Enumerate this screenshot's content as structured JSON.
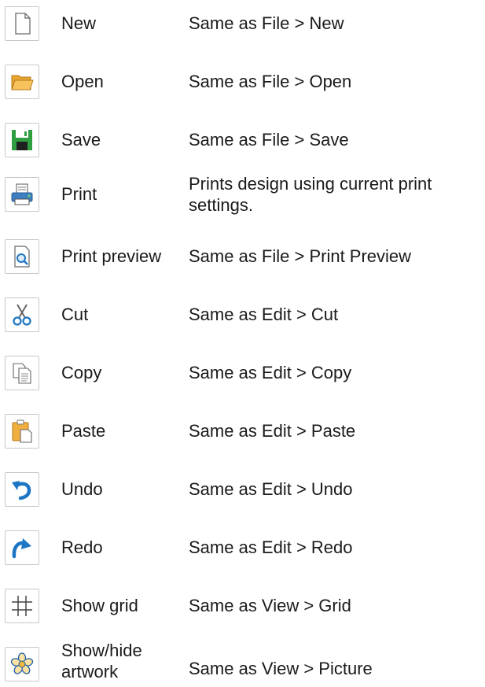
{
  "rows": [
    {
      "icon": "new-document-icon",
      "name": "New",
      "desc": "Same as File > New"
    },
    {
      "icon": "open-folder-icon",
      "name": "Open",
      "desc": "Same as File > Open"
    },
    {
      "icon": "save-floppy-icon",
      "name": "Save",
      "desc": "Same as File > Save"
    },
    {
      "icon": "printer-icon",
      "name": "Print",
      "desc_line1": "Prints design using current print",
      "desc_line2": "settings."
    },
    {
      "icon": "print-preview-icon",
      "name": "Print preview",
      "desc": "Same as File > Print Preview"
    },
    {
      "icon": "scissors-cut-icon",
      "name": "Cut",
      "desc": "Same as Edit > Cut"
    },
    {
      "icon": "copy-icon",
      "name": "Copy",
      "desc": "Same as Edit > Copy"
    },
    {
      "icon": "paste-clipboard-icon",
      "name": "Paste",
      "desc": "Same as Edit > Paste"
    },
    {
      "icon": "undo-arrow-icon",
      "name": "Undo",
      "desc": "Same as Edit > Undo"
    },
    {
      "icon": "redo-arrow-icon",
      "name": "Redo",
      "desc": "Same as Edit > Redo"
    },
    {
      "icon": "grid-icon",
      "name": "Show grid",
      "desc": "Same as View > Grid"
    },
    {
      "icon": "flower-artwork-icon",
      "name_line1": "Show/hide",
      "name_line2": "artwork",
      "desc": "Same as View > Picture"
    }
  ],
  "colors": {
    "icon_border": "#c8c8c8",
    "save_green": "#2f9e41",
    "folder_orange": "#f0b040",
    "undo_blue": "#1d76c4"
  }
}
